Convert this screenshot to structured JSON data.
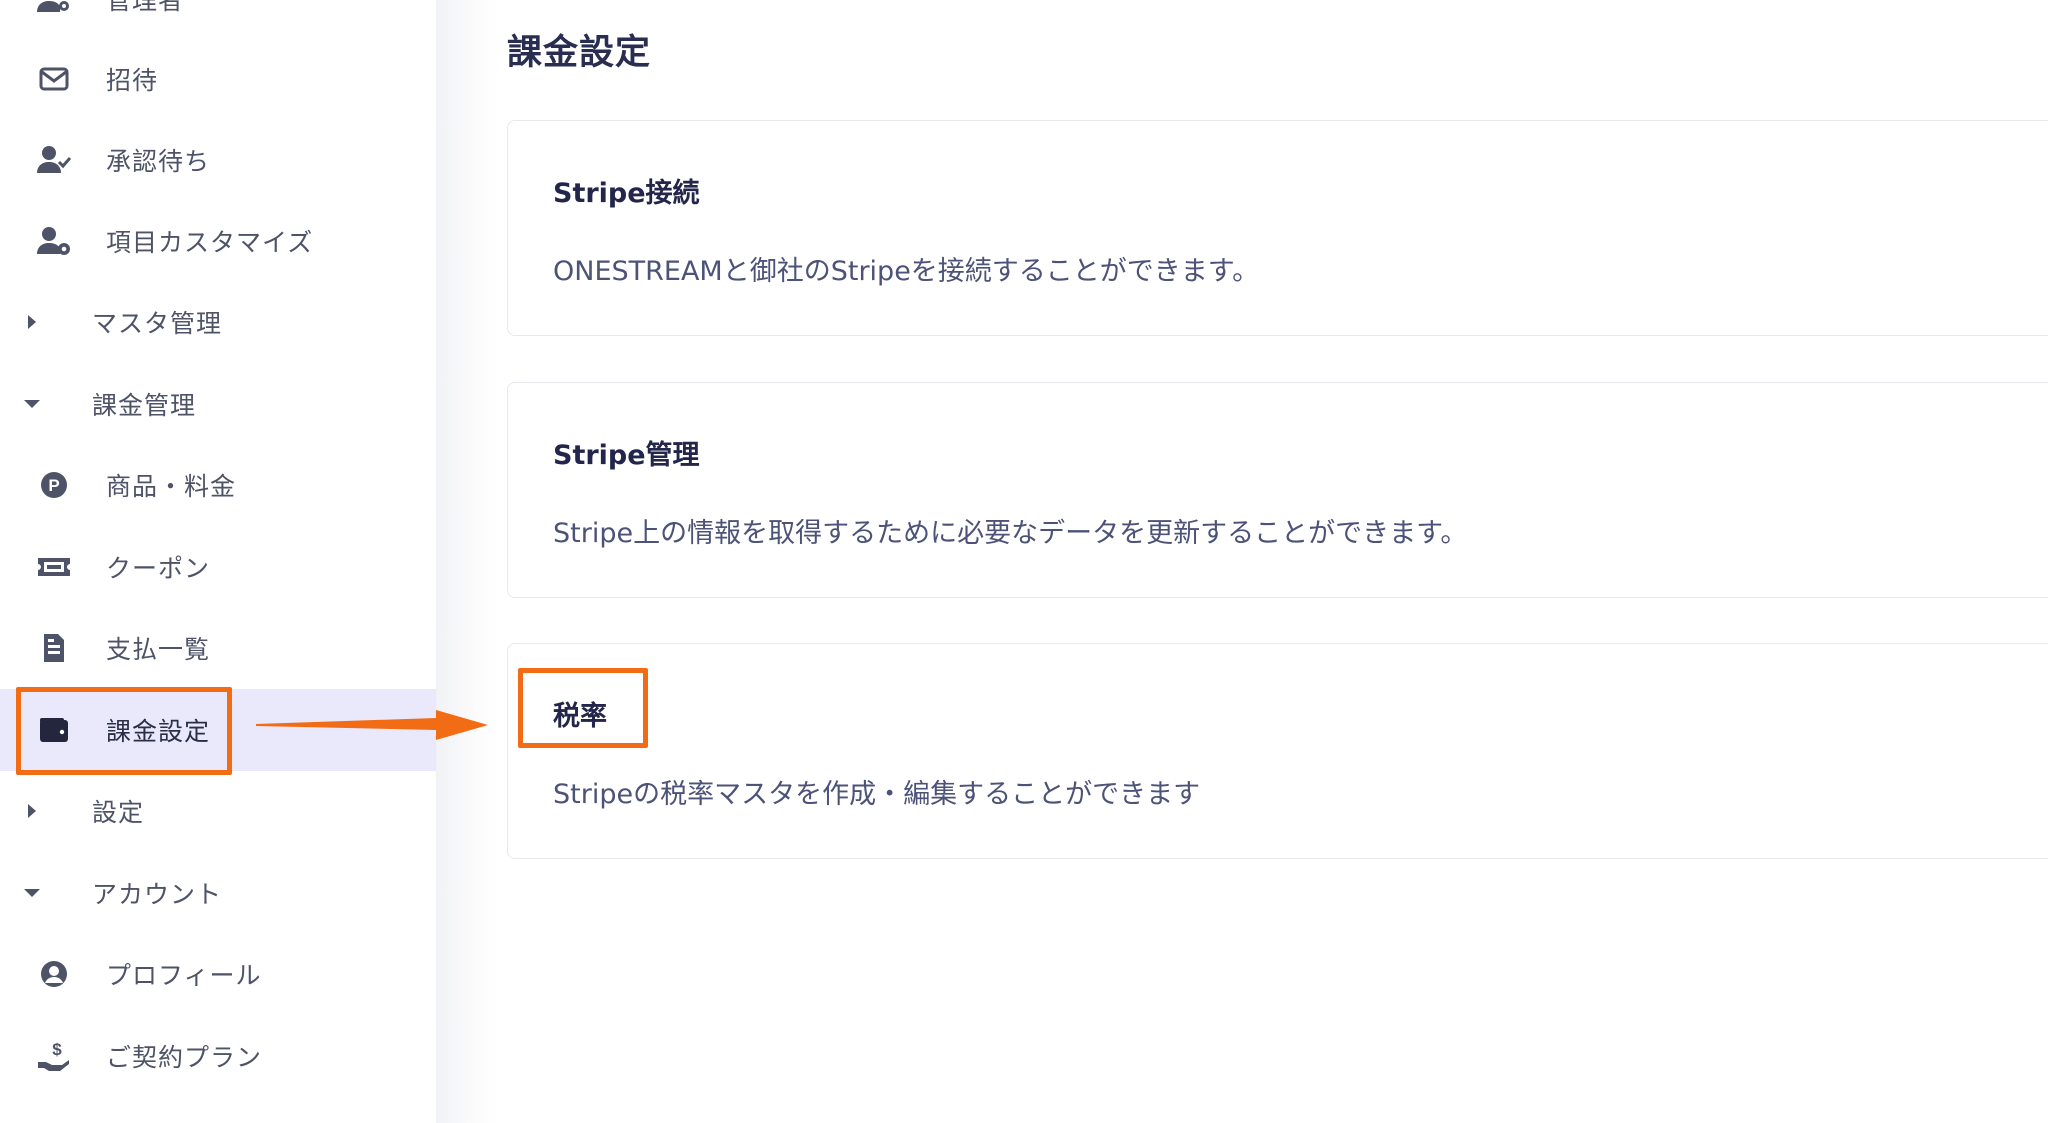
{
  "sidebar": {
    "items": [
      {
        "label": "管理者",
        "icon": "user-gear-icon",
        "type": "item"
      },
      {
        "label": "招待",
        "icon": "envelope-icon",
        "type": "item"
      },
      {
        "label": "承認待ち",
        "icon": "user-check-icon",
        "type": "item"
      },
      {
        "label": "項目カスタマイズ",
        "icon": "user-cog-icon",
        "type": "item"
      },
      {
        "label": "マスタ管理",
        "icon": "caret-right-icon",
        "type": "group"
      },
      {
        "label": "課金管理",
        "icon": "caret-down-icon",
        "type": "group"
      },
      {
        "label": "商品・料金",
        "icon": "p-circle-icon",
        "type": "item"
      },
      {
        "label": "クーポン",
        "icon": "ticket-icon",
        "type": "item"
      },
      {
        "label": "支払一覧",
        "icon": "invoice-icon",
        "type": "item"
      },
      {
        "label": "課金設定",
        "icon": "wallet-icon",
        "type": "item",
        "active": true
      },
      {
        "label": "設定",
        "icon": "caret-right-icon",
        "type": "group"
      },
      {
        "label": "アカウント",
        "icon": "caret-down-icon",
        "type": "group"
      },
      {
        "label": "プロフィール",
        "icon": "user-circle-icon",
        "type": "item"
      },
      {
        "label": "ご契約プラン",
        "icon": "hand-dollar-icon",
        "type": "item"
      }
    ]
  },
  "main": {
    "title": "課金設定",
    "cards": [
      {
        "title": "Stripe接続",
        "description": "ONESTREAMと御社のStripeを接続することができます。"
      },
      {
        "title": "Stripe管理",
        "description": "Stripe上の情報を取得するために必要なデータを更新することができます。"
      },
      {
        "title": "税率",
        "description": "Stripeの税率マスタを作成・編集することができます"
      }
    ]
  },
  "annotations": {
    "highlight_color": "#f26b15",
    "active_bg": "#e9e9fb"
  }
}
